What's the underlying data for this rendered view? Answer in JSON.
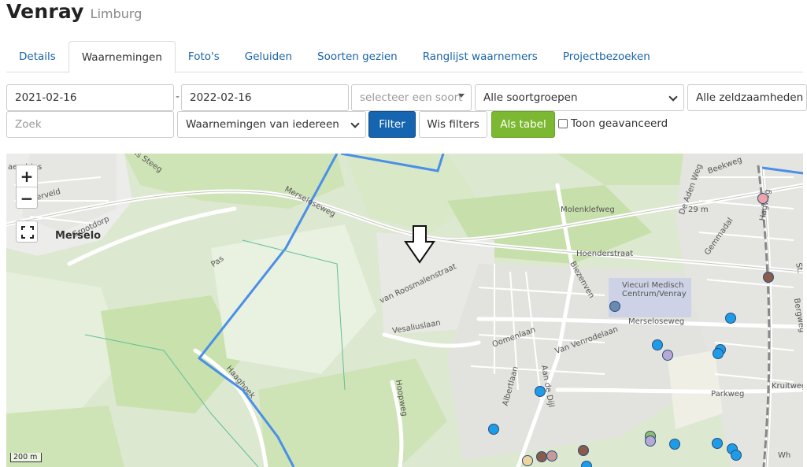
{
  "header": {
    "title": "Venray",
    "subtitle": "Limburg"
  },
  "tabs": [
    {
      "label": "Details",
      "active": false
    },
    {
      "label": "Waarnemingen",
      "active": true
    },
    {
      "label": "Foto's",
      "active": false
    },
    {
      "label": "Geluiden",
      "active": false
    },
    {
      "label": "Soorten gezien",
      "active": false
    },
    {
      "label": "Ranglijst waarnemers",
      "active": false
    },
    {
      "label": "Projectbezoeken",
      "active": false
    }
  ],
  "filters": {
    "date_from": "2021-02-16",
    "date_separator": "-",
    "date_to": "2022-02-16",
    "species_placeholder": "selecteer een soort",
    "species_group": "Alle soortgroepen",
    "rarity": "Alle zeldzaamheden",
    "search_placeholder": "Zoek",
    "observations_scope": "Waarnemingen van iedereen",
    "filter_button": "Filter",
    "clear_button": "Wis filters",
    "table_button": "Als tabel",
    "advanced_label": "Toon geavanceerd"
  },
  "map": {
    "town_label": "Merselo",
    "zoom_in": "+",
    "zoom_out": "−",
    "scale_label": "200 m",
    "street_labels": [
      "Merseloseweg",
      "Molenklefweg",
      "Hoenderstraat",
      "Mersel oseweg",
      "Pas",
      "Grootdorp",
      "Dorperveld",
      "van Roosmalenstraat",
      "Vesaliuslaan",
      "Oomenlaan",
      "Van Venrodelaan",
      "Merseloseweg",
      "Viecuri Medisch Centrum/Venray",
      "Parkweg",
      "Kruitweg",
      "Hoopweg",
      "Haaghoek",
      "Albertlaan",
      "Aan de Dijl",
      "De Aden Weg",
      "Gemmadal",
      "29 m",
      "Bergweg",
      "St.",
      "Beekweg",
      "Wh",
      "Is Steeg",
      "aendries",
      "Hagweg",
      "Biezenven"
    ],
    "marker_colors": {
      "blue": "#1e9ce8",
      "pink": "#f0a3a8",
      "brown": "#8a5a4a",
      "lavender": "#b6a9d6",
      "green": "#8fbf6a"
    }
  }
}
